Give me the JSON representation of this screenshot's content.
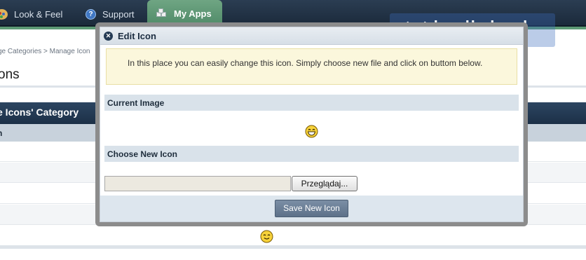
{
  "nav": {
    "tabs": [
      {
        "label": "Look & Feel",
        "icon": "palette-icon"
      },
      {
        "label": "Support",
        "icon": "help-icon"
      },
      {
        "label": "My Apps",
        "icon": "cubes-icon",
        "active": true
      }
    ]
  },
  "page": {
    "breadcrumb": "ge Categories  >  Manage Icon",
    "title": "ons",
    "category_header": "e Icons' Category",
    "column_header": "n"
  },
  "watermark": {
    "text": "ipslink.pl"
  },
  "modal": {
    "title": "Edit Icon",
    "info": "In this place you can easily change this icon. Simply choose new file and click on buttom below.",
    "current_image_label": "Current Image",
    "choose_icon_label": "Choose New Icon",
    "browse_label": "Przeglądaj...",
    "save_label": "Save New Icon"
  },
  "colors": {
    "nav_bg": "#1b2a3b",
    "active_tab": "#5d9a75",
    "section_bg": "#d9e2ea",
    "save_button": "#6b7f96",
    "info_bg": "#fbf7dc"
  }
}
